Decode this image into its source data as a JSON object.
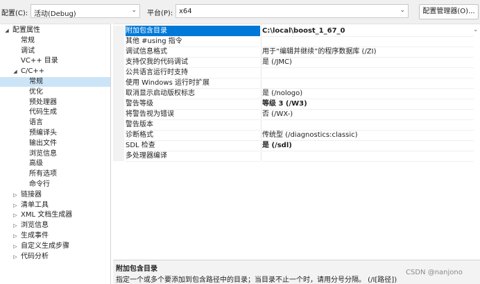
{
  "toolbar": {
    "config_label": "配置(C):",
    "config_value": "活动(Debug)",
    "platform_label": "平台(P):",
    "platform_value": "x64",
    "config_manager_button": "配置管理器(O)..."
  },
  "tree": [
    {
      "label": "配置属性",
      "level": 0,
      "twisty": "expanded"
    },
    {
      "label": "常规",
      "level": 1
    },
    {
      "label": "调试",
      "level": 1
    },
    {
      "label": "VC++ 目录",
      "level": 1
    },
    {
      "label": "C/C++",
      "level": 1,
      "twisty": "expanded"
    },
    {
      "label": "常规",
      "level": 2,
      "selected": true
    },
    {
      "label": "优化",
      "level": 2
    },
    {
      "label": "预处理器",
      "level": 2
    },
    {
      "label": "代码生成",
      "level": 2
    },
    {
      "label": "语言",
      "level": 2
    },
    {
      "label": "预编译头",
      "level": 2
    },
    {
      "label": "输出文件",
      "level": 2
    },
    {
      "label": "浏览信息",
      "level": 2
    },
    {
      "label": "高级",
      "level": 2
    },
    {
      "label": "所有选项",
      "level": 2
    },
    {
      "label": "命令行",
      "level": 2
    },
    {
      "label": "链接器",
      "level": 1,
      "twisty": "collapsed"
    },
    {
      "label": "清单工具",
      "level": 1,
      "twisty": "collapsed"
    },
    {
      "label": "XML 文档生成器",
      "level": 1,
      "twisty": "collapsed"
    },
    {
      "label": "浏览信息",
      "level": 1,
      "twisty": "collapsed"
    },
    {
      "label": "生成事件",
      "level": 1,
      "twisty": "collapsed"
    },
    {
      "label": "自定义生成步骤",
      "level": 1,
      "twisty": "collapsed"
    },
    {
      "label": "代码分析",
      "level": 1,
      "twisty": "collapsed"
    }
  ],
  "properties": [
    {
      "name": "附加包含目录",
      "value": "C:\\local\\boost_1_67_0",
      "bold": true,
      "selected": true
    },
    {
      "name": "其他 #using 指令",
      "value": ""
    },
    {
      "name": "调试信息格式",
      "value": "用于“编辑并继续”的程序数据库 (/ZI)"
    },
    {
      "name": "支持仅我的代码调试",
      "value": "是 (/JMC)"
    },
    {
      "name": "公共语言运行时支持",
      "value": ""
    },
    {
      "name": "使用 Windows 运行时扩展",
      "value": ""
    },
    {
      "name": "取消显示启动版权标志",
      "value": "是 (/nologo)"
    },
    {
      "name": "警告等级",
      "value": "等级 3 (/W3)",
      "bold": true
    },
    {
      "name": "将警告视为错误",
      "value": "否 (/WX-)"
    },
    {
      "name": "警告版本",
      "value": ""
    },
    {
      "name": "诊断格式",
      "value": "传统型 (/diagnostics:classic)"
    },
    {
      "name": "SDL 检查",
      "value": "是 (/sdl)",
      "bold": true
    },
    {
      "name": "多处理器编译",
      "value": ""
    }
  ],
  "description": {
    "title": "附加包含目录",
    "text": "指定一个或多个要添加到包含路径中的目录；当目录不止一个时，请用分号分隔。    (/I[路径])"
  },
  "watermark": "CSDN @nanjono",
  "icons": {
    "combo_arrow": "chevron-down-icon",
    "twisty_expanded": "triangle-down-icon",
    "twisty_collapsed": "triangle-right-icon"
  }
}
